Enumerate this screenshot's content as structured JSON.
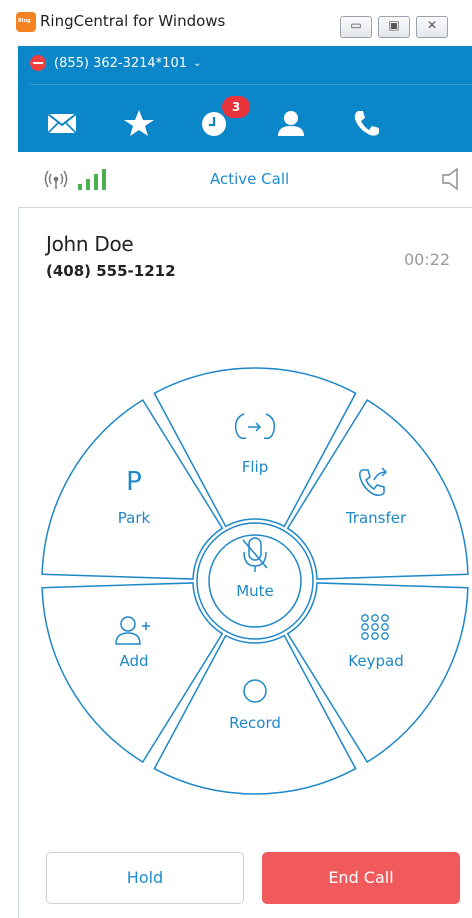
{
  "window": {
    "title": "RingCentral for Windows",
    "min_glyph": "▭",
    "max_glyph": "▣",
    "close_glyph": "✕"
  },
  "header": {
    "presence_number": "(855) 362-3214*101",
    "presence_chevron": "⌄",
    "presence_status": "do-not-disturb",
    "nav": [
      {
        "icon": "messages-icon"
      },
      {
        "icon": "favorites-star-icon"
      },
      {
        "icon": "recent-calls-icon",
        "badge": "3"
      },
      {
        "icon": "contacts-icon"
      },
      {
        "icon": "phone-icon"
      }
    ]
  },
  "status": {
    "label": "Active Call",
    "signal_bars": 4
  },
  "caller": {
    "name": "John Doe",
    "number": "(408) 555-1212",
    "timer": "00:22"
  },
  "controls": {
    "flip": "Flip",
    "transfer": "Transfer",
    "keypad": "Keypad",
    "record": "Record",
    "add": "Add",
    "park": "Park",
    "mute": "Mute",
    "park_glyph": "P"
  },
  "buttons": {
    "hold": "Hold",
    "end_call": "End Call"
  },
  "colors": {
    "brand_blue": "#0b86c9",
    "accent_text": "#1f88c8",
    "end_call_red": "#f05a5d",
    "badge_red": "#e8333b",
    "signal_green": "#4caf50"
  }
}
